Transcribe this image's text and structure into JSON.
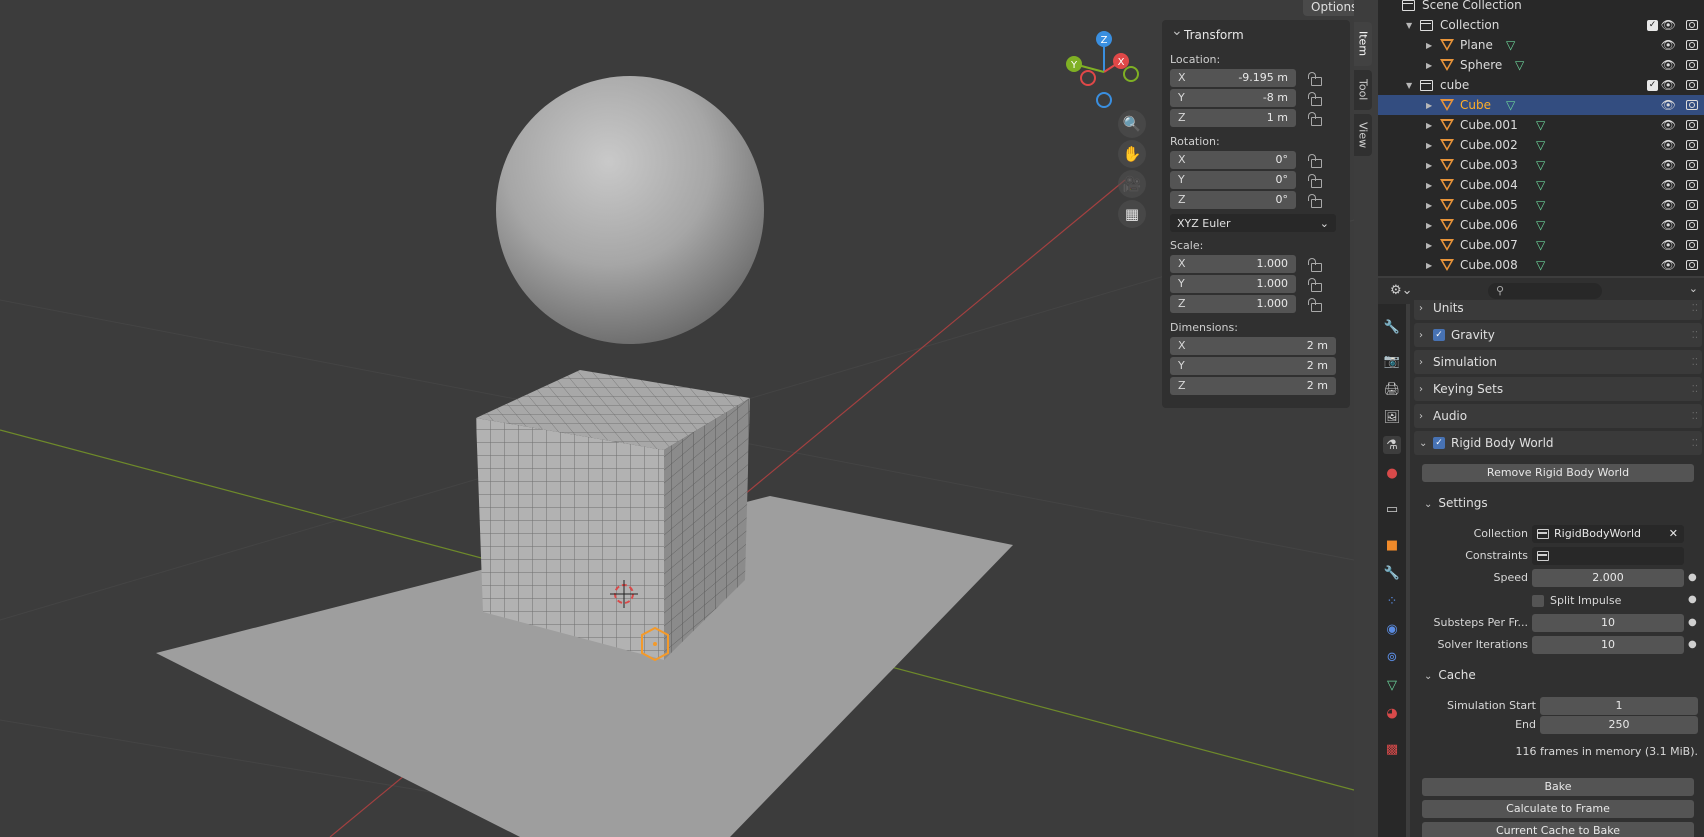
{
  "viewport": {
    "options_label": "Options"
  },
  "n_panel": {
    "tabs": [
      "Item",
      "Tool",
      "View"
    ],
    "panel_title": "Transform",
    "location_label": "Location:",
    "location": [
      {
        "axis": "X",
        "value": "-9.195 m"
      },
      {
        "axis": "Y",
        "value": "-8 m"
      },
      {
        "axis": "Z",
        "value": "1 m"
      }
    ],
    "rotation_label": "Rotation:",
    "rotation": [
      {
        "axis": "X",
        "value": "0°"
      },
      {
        "axis": "Y",
        "value": "0°"
      },
      {
        "axis": "Z",
        "value": "0°"
      }
    ],
    "rotation_mode": "XYZ Euler",
    "scale_label": "Scale:",
    "scale": [
      {
        "axis": "X",
        "value": "1.000"
      },
      {
        "axis": "Y",
        "value": "1.000"
      },
      {
        "axis": "Z",
        "value": "1.000"
      }
    ],
    "dimensions_label": "Dimensions:",
    "dimensions": [
      {
        "axis": "X",
        "value": "2 m"
      },
      {
        "axis": "Y",
        "value": "2 m"
      },
      {
        "axis": "Z",
        "value": "2 m"
      }
    ]
  },
  "gizmo": {
    "x": "X",
    "y": "Y",
    "z": "Z"
  },
  "outliner": {
    "rows": [
      {
        "name": "Scene Collection",
        "type": "scene"
      },
      {
        "name": "Collection",
        "type": "collection",
        "checked": true
      },
      {
        "name": "Plane",
        "type": "mesh"
      },
      {
        "name": "Sphere",
        "type": "mesh"
      },
      {
        "name": "cube",
        "type": "collection",
        "checked": true
      },
      {
        "name": "Cube",
        "type": "mesh",
        "selected": true
      },
      {
        "name": "Cube.001",
        "type": "mesh"
      },
      {
        "name": "Cube.002",
        "type": "mesh"
      },
      {
        "name": "Cube.003",
        "type": "mesh"
      },
      {
        "name": "Cube.004",
        "type": "mesh"
      },
      {
        "name": "Cube.005",
        "type": "mesh"
      },
      {
        "name": "Cube.006",
        "type": "mesh"
      },
      {
        "name": "Cube.007",
        "type": "mesh"
      },
      {
        "name": "Cube.008",
        "type": "mesh"
      }
    ]
  },
  "properties": {
    "search_placeholder": "",
    "sections": {
      "units": "Units",
      "gravity": "Gravity",
      "simulation": "Simulation",
      "keying_sets": "Keying Sets",
      "audio": "Audio",
      "rigid_body_world": "Rigid Body World"
    },
    "remove_rbw": "Remove Rigid Body World",
    "settings_title": "Settings",
    "collection_label": "Collection",
    "collection_value": "RigidBodyWorld",
    "constraints_label": "Constraints",
    "speed_label": "Speed",
    "speed_value": "2.000",
    "split_impulse_label": "Split Impulse",
    "substeps_label": "Substeps Per Fr...",
    "substeps_value": "10",
    "solver_label": "Solver Iterations",
    "solver_value": "10",
    "cache_title": "Cache",
    "sim_start_label": "Simulation Start",
    "sim_start_value": "1",
    "end_label": "End",
    "end_value": "250",
    "frames_info": "116 frames in memory (3.1 MiB).",
    "bake": "Bake",
    "calc_to_frame": "Calculate to Frame",
    "current_cache_to_bake": "Current Cache to Bake"
  },
  "colors": {
    "selection": "#334d80",
    "active_text": "#ffaf29",
    "axis_x": "#e04848",
    "axis_y": "#7fb024",
    "axis_z": "#3a8fe0"
  }
}
